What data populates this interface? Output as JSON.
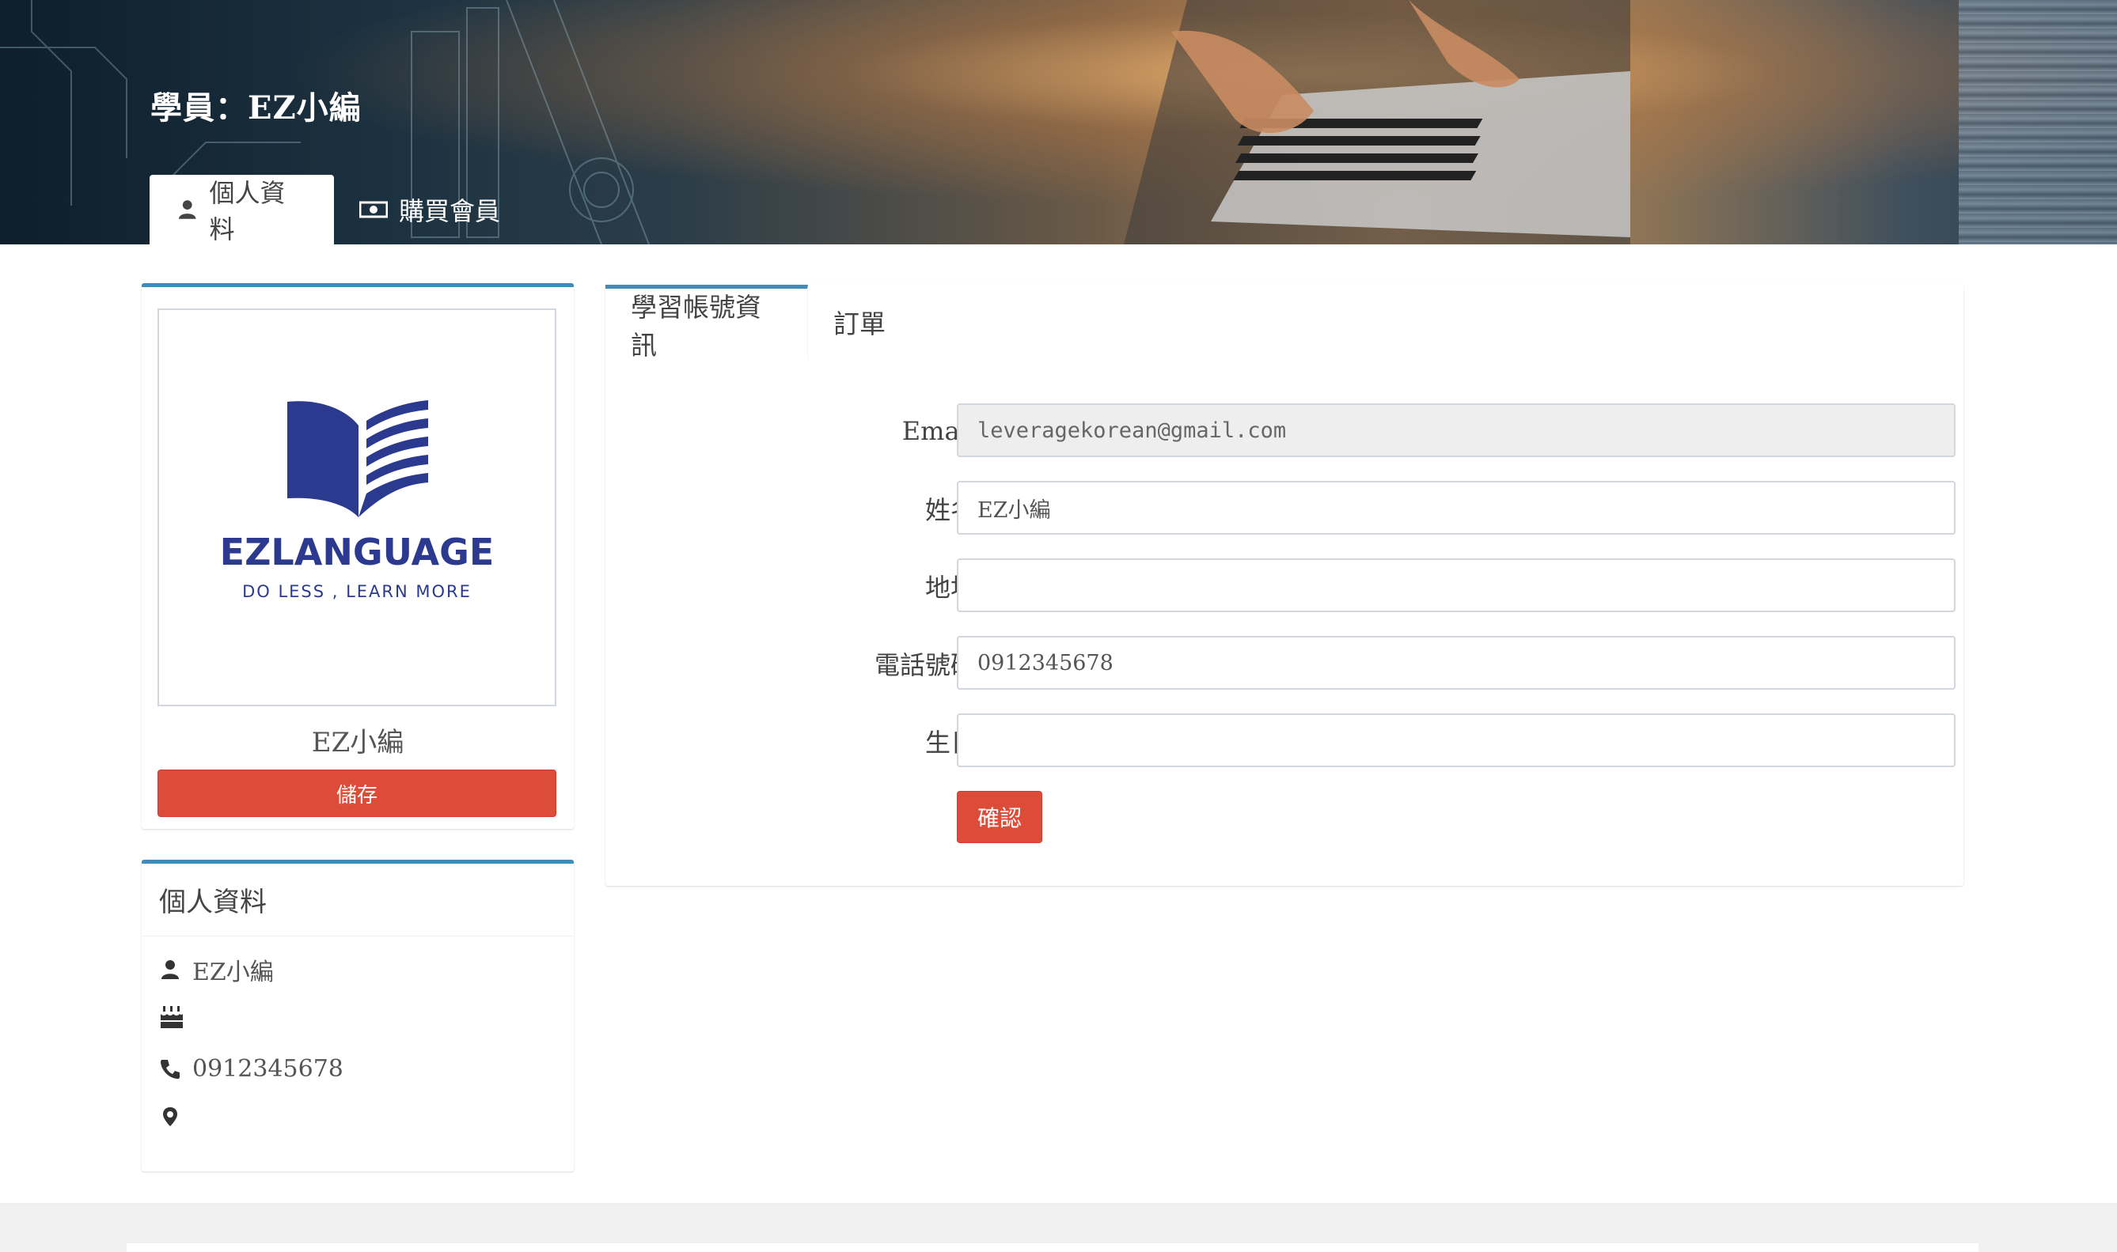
{
  "header": {
    "title": "學員：EZ小編",
    "tabs": [
      {
        "label": "個人資料",
        "icon": "user-icon",
        "active": true
      },
      {
        "label": "購買會員",
        "icon": "money-icon",
        "active": false
      }
    ]
  },
  "profile": {
    "logo": {
      "brand": "EZLANGUAGE",
      "tagline": "DO LESS , LEARN MORE",
      "color": "#2b3a8f"
    },
    "name": "EZ小編",
    "save_label": "儲存"
  },
  "info": {
    "title": "個人資料",
    "name": "EZ小編",
    "birthday": "",
    "phone": "0912345678",
    "address": ""
  },
  "main": {
    "tabs": [
      {
        "label": "學習帳號資訊",
        "active": true
      },
      {
        "label": "訂單",
        "active": false
      }
    ],
    "form": {
      "email_label": "Email",
      "email_value": "leveragekorean@gmail.com",
      "name_label": "姓名",
      "name_value": "EZ小編",
      "address_label": "地址",
      "address_value": "",
      "phone_label": "電話號碼",
      "phone_value": "0912345678",
      "birthday_label": "生日",
      "birthday_value": ""
    },
    "confirm_label": "確認"
  },
  "colors": {
    "accent": "#3c8dbc",
    "danger": "#dd4b39"
  }
}
